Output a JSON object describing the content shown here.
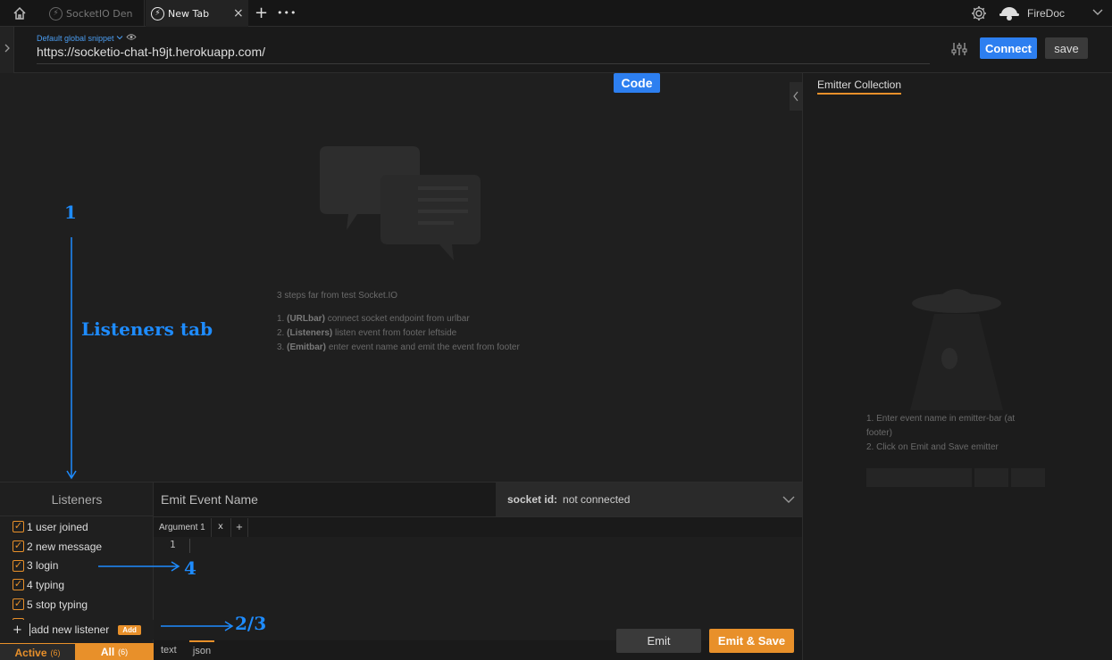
{
  "tabs": [
    {
      "label": "SocketIO Den",
      "icon": "socketio-icon"
    },
    {
      "label": "New Tab",
      "icon": "socketio-icon"
    }
  ],
  "tab_close": "×",
  "tab_add": "+",
  "tab_more": "•••",
  "user": {
    "name": "FireDoc"
  },
  "urlbar": {
    "snippet": "Default global snippet",
    "url": "https://socketio-chat-h9jt.herokuapp.com/"
  },
  "buttons": {
    "connect": "Connect",
    "save": "save",
    "code": "Code",
    "emit": "Emit",
    "emit_save": "Emit & Save",
    "add": "Add"
  },
  "intro": {
    "heading": "3 steps far from test Socket.IO",
    "steps": [
      {
        "num": "1.",
        "bold": "(URLbar)",
        "text": "connect socket endpoint from urlbar"
      },
      {
        "num": "2.",
        "bold": "(Listeners)",
        "text": "listen event from footer leftside"
      },
      {
        "num": "3.",
        "bold": "(Emitbar)",
        "text": "enter event name and emit the event from footer"
      }
    ]
  },
  "emitter_collection": {
    "title": "Emitter Collection",
    "steps": [
      "1. Enter event name in emitter-bar (at footer)",
      "2. Click on Emit and Save emitter"
    ]
  },
  "listeners": {
    "title": "Listeners",
    "items": [
      "1 user joined",
      "2 new message",
      "3 login",
      "4 typing",
      "5 stop typing"
    ],
    "add_placeholder": "add new listener",
    "active_label": "Active",
    "active_count": "(6)",
    "all_label": "All",
    "all_count": "(6)"
  },
  "emit": {
    "placeholder": "Emit Event Name",
    "argument_tab": "Argument 1",
    "line_number": "1",
    "modes": [
      "text",
      "json"
    ]
  },
  "socket": {
    "label": "socket id:",
    "value": "not connected"
  },
  "annotations": {
    "n1": "1",
    "listeners_tab": "Listeners tab",
    "n4": "4",
    "n23": "2/3"
  },
  "colors": {
    "accent_blue": "#2d7ff0",
    "accent_orange": "#e8902a",
    "annotation_blue": "#1e8cff",
    "background": "#1e1e1e"
  }
}
